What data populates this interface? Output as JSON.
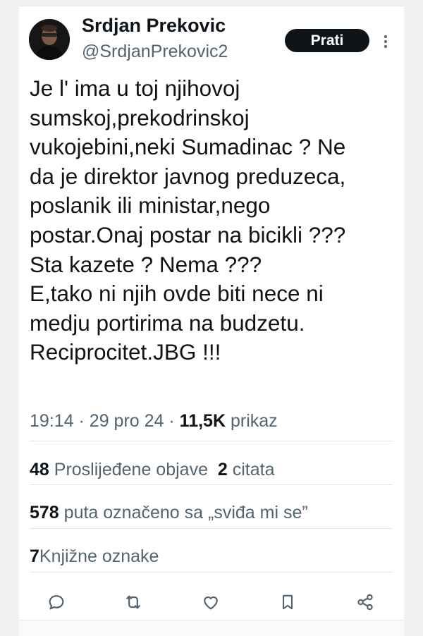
{
  "author": {
    "name": "Srdjan Prekovic",
    "handle": "@SrdjanPrekovic2"
  },
  "follow_label": "Prati",
  "tweet": {
    "lines": [
      "Je l' ima u toj njihovoj",
      "sumskoj,prekodrinskoj",
      "vukojebini,neki Sumadinac ? Ne",
      "da je direktor javnog preduzeca,",
      "poslanik ili ministar,nego",
      "postar.Onaj postar na bicikli ???",
      "Sta kazete ? Nema ???",
      "E,tako ni njih ovde biti nece ni",
      "medju portirima na budzetu.",
      "Reciprocitet.JBG !!!"
    ]
  },
  "meta": {
    "time": "19:14",
    "separator": "·",
    "date": "29 pro 24",
    "views_count": "11,5K",
    "views_label": "prikaz"
  },
  "stats": {
    "reposts_count": "48",
    "reposts_label": "Proslijeđene objave",
    "quotes_count": "2",
    "quotes_label": "citata",
    "likes_count": "578",
    "likes_label": "puta označeno sa „sviđa mi se”",
    "bookmarks_count": "7",
    "bookmarks_label": "Knjižne oznake"
  },
  "actions": [
    "reply-icon",
    "repost-icon",
    "like-icon",
    "bookmark-icon",
    "share-icon"
  ],
  "colors": {
    "text": "#0f1419",
    "secondary": "#536471",
    "divider": "#e3e6e8",
    "button_bg": "#0f1419"
  }
}
